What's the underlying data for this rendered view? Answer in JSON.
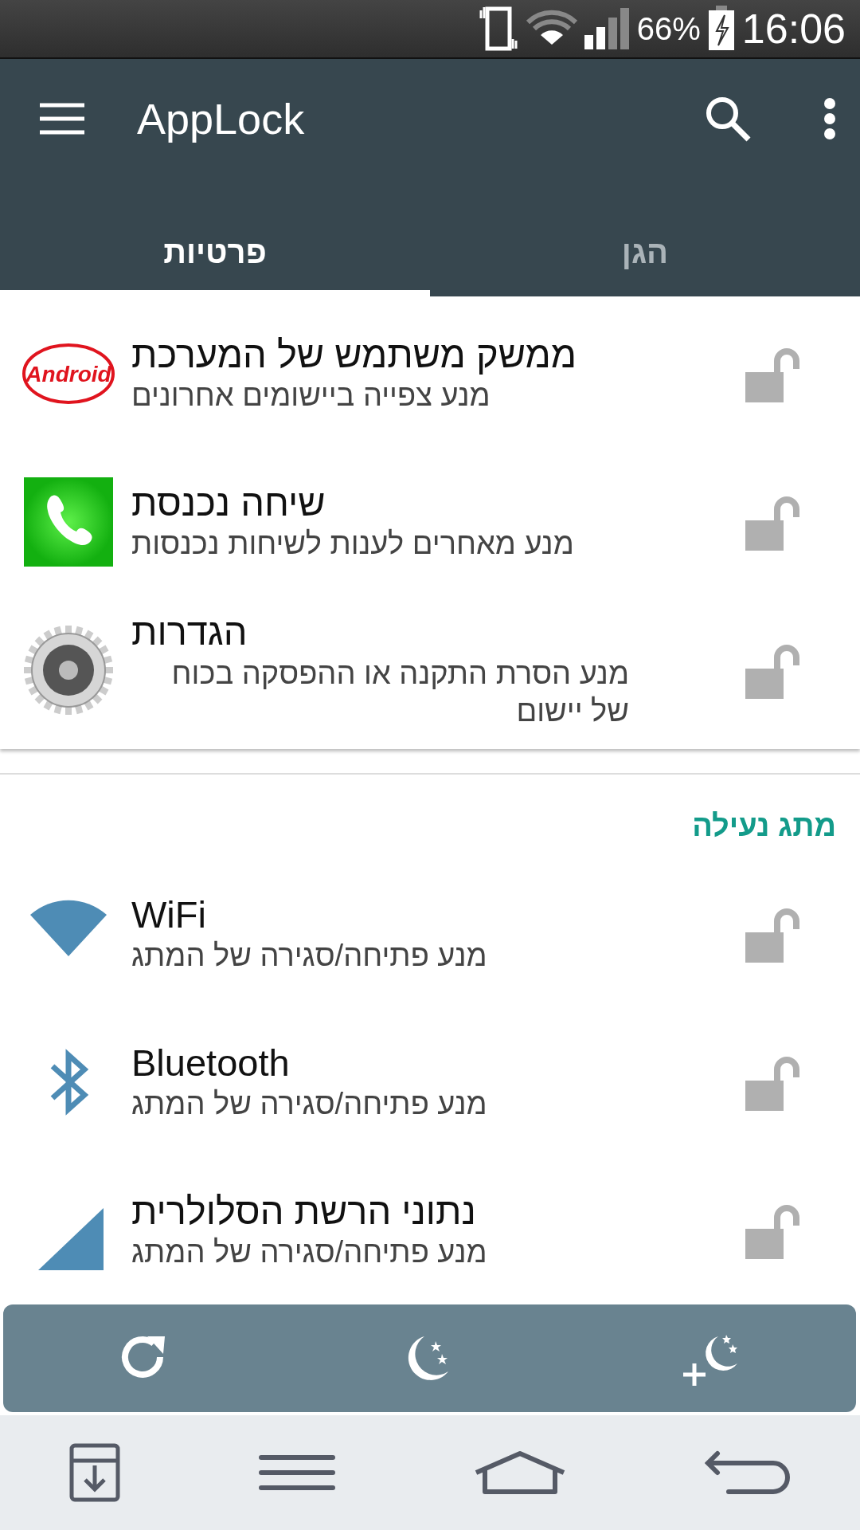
{
  "status_bar": {
    "battery": "66%",
    "time": "16:06"
  },
  "app_bar": {
    "title": "AppLock"
  },
  "tabs": [
    {
      "label": "הגן",
      "selected": false
    },
    {
      "label": "פרטיות",
      "selected": true
    }
  ],
  "privacy_items": [
    {
      "kind": "android",
      "logo_text": "Android",
      "title": "ממשק משתמש של המערכת",
      "subtitle": "מנע צפייה ביישומים אחרונים",
      "locked": false
    },
    {
      "kind": "phone",
      "title": "שיחה נכנסת",
      "subtitle": "מנע מאחרים לענות לשיחות נכנסות",
      "locked": false
    },
    {
      "kind": "settings",
      "title": "הגדרות",
      "subtitle": "מנע הסרת התקנה או ההפסקה בכוח של יישום",
      "locked": false
    }
  ],
  "switch_section": {
    "title": "מתג נעילה",
    "items": [
      {
        "kind": "wifi",
        "title": "WiFi",
        "subtitle": "מנע פתיחה/סגירה של המתג",
        "locked": false
      },
      {
        "kind": "bluetooth",
        "title": "Bluetooth",
        "subtitle": "מנע פתיחה/סגירה של המתג",
        "locked": false
      },
      {
        "kind": "cellular",
        "title": "נתוני הרשת הסלולרית",
        "subtitle": "מנע פתיחה/סגירה של המתג",
        "locked": false
      }
    ]
  }
}
